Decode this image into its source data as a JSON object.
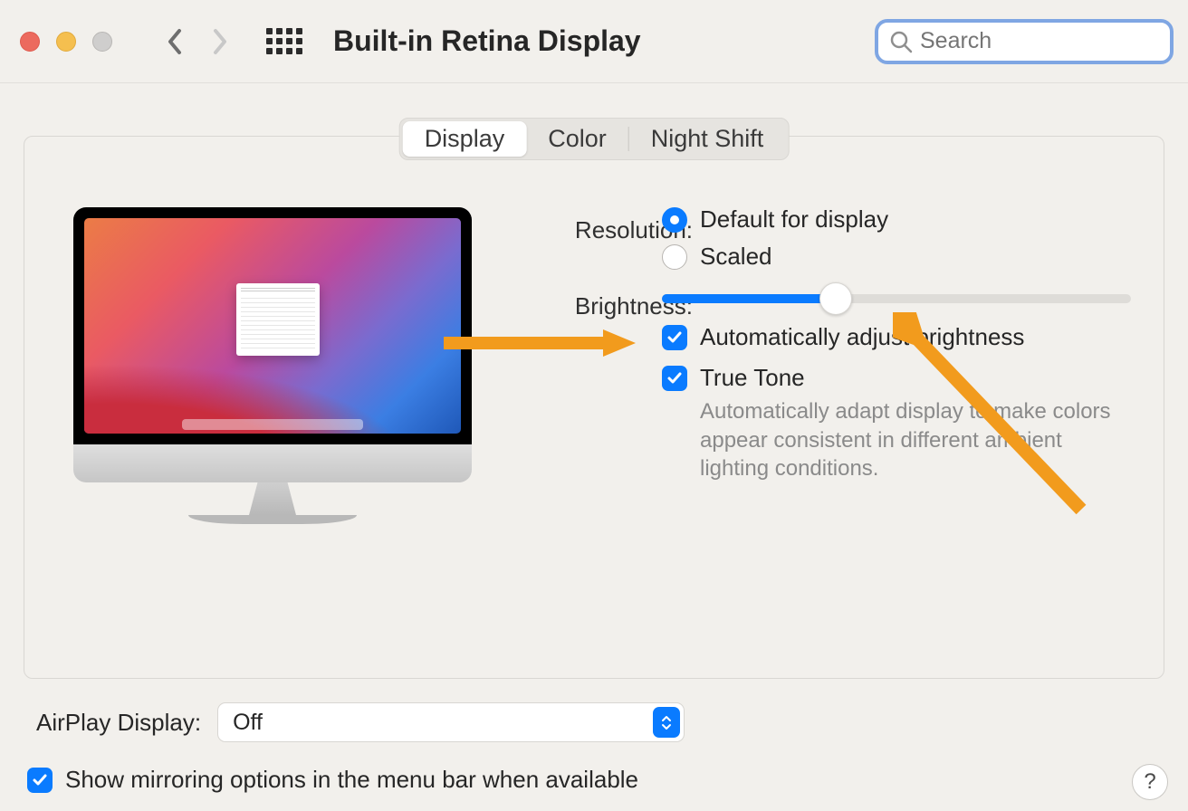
{
  "window": {
    "title": "Built-in Retina Display"
  },
  "search": {
    "placeholder": "Search"
  },
  "tabs": [
    {
      "label": "Display",
      "active": true
    },
    {
      "label": "Color",
      "active": false
    },
    {
      "label": "Night Shift",
      "active": false
    }
  ],
  "resolution": {
    "label": "Resolution:",
    "options": [
      {
        "label": "Default for display",
        "selected": true
      },
      {
        "label": "Scaled",
        "selected": false
      }
    ]
  },
  "brightness": {
    "label": "Brightness:",
    "value_percent": 37
  },
  "checkboxes": {
    "auto_brightness": {
      "label": "Automatically adjust brightness",
      "checked": true
    },
    "true_tone": {
      "label": "True Tone",
      "checked": true,
      "description": "Automatically adapt display to make colors appear consistent in different ambient lighting conditions."
    }
  },
  "airplay": {
    "label": "AirPlay Display:",
    "value": "Off"
  },
  "mirroring": {
    "label": "Show mirroring options in the menu bar when available",
    "checked": true
  },
  "help": {
    "symbol": "?"
  },
  "colors": {
    "accent": "#0a7bff",
    "annotation": "#f29b1d"
  }
}
